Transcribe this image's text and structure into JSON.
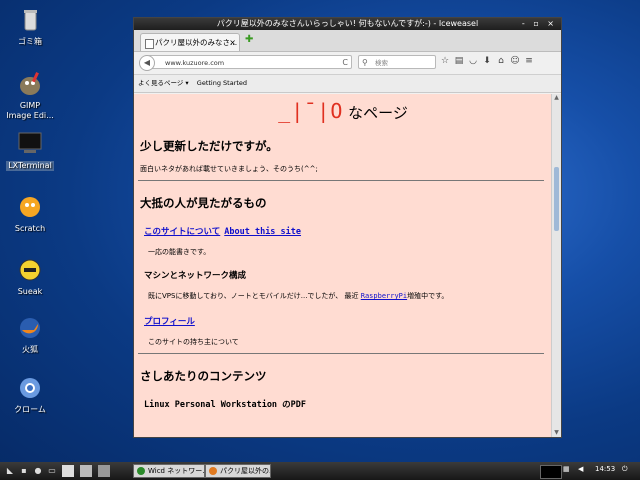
{
  "desktop": {
    "icons": [
      {
        "label": "ゴミ箱"
      },
      {
        "label": "GIMP\nImage Edi..."
      },
      {
        "label": "LXTerminal"
      },
      {
        "label": "Scratch"
      },
      {
        "label": "Sueak"
      },
      {
        "label": "火狐"
      },
      {
        "label": "クローム"
      }
    ]
  },
  "window": {
    "title": "パクリ屋以外のみなさんいらっしゃい! 何もないんですが:-) - Iceweasel",
    "controls": "- ▫ ×",
    "tab_label": "パクリ屋以外のみなさ...",
    "tab_close": "×",
    "newtab": "✚",
    "url": "www.kuzuore.com",
    "reload": "C",
    "search_placeholder": "検索",
    "bookmarks": [
      "よく見るページ ▾",
      "Getting Started"
    ]
  },
  "page": {
    "logo": "_|¯|O",
    "title_rest": " なページ",
    "section1": {
      "heading": "少し更新しただけですが。",
      "text": "面白いネタがあれば載せていきましょう、そのうち(^^;"
    },
    "section2": {
      "heading": "大抵の人が見たがるもの",
      "about_jp": "このサイトについて",
      "about_en": "About this site",
      "about_desc": "一応の能書きです。",
      "machine_heading": "マシンとネットワーク構成",
      "machine_pre": "既にVPSに移動しており、ノートとモバイルだけ...でしたが、 最近 ",
      "machine_link": "RaspberryPi",
      "machine_post": "増殖中です。",
      "profile": "プロフィール",
      "profile_desc": "このサイトの持ち主について"
    },
    "section3": {
      "heading": "さしあたりのコンテンツ",
      "item1": "Linux Personal Workstation のPDF"
    }
  },
  "taskbar": {
    "tasks": [
      "Wicd ネットワー...",
      "パクリ屋以外の..."
    ],
    "clock": "14:53"
  }
}
